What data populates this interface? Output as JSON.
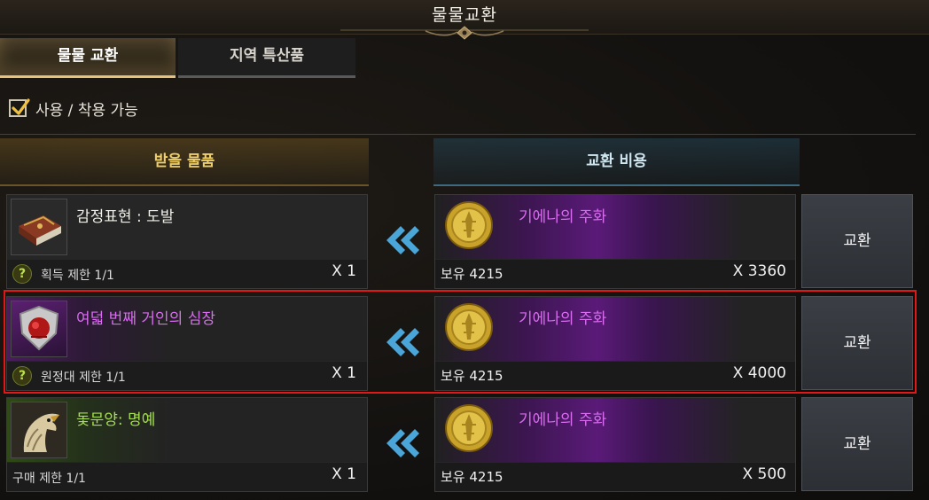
{
  "window": {
    "title": "물물교환"
  },
  "tabs": [
    {
      "label": "물물 교환",
      "active": true
    },
    {
      "label": "지역 특산품",
      "active": false
    }
  ],
  "filter": {
    "label": "사용 / 착용 가능",
    "checked": true
  },
  "columns": {
    "receive": "받을 물품",
    "cost": "교환 비용"
  },
  "rows": [
    {
      "item": {
        "name": "감정표현 : 도발",
        "name_color": "#f0efe8",
        "icon": "book-icon",
        "limit": "획득 제한 1/1",
        "quantity": "X 1"
      },
      "cost": {
        "name": "기에나의 주화",
        "icon": "gold-coin-icon",
        "owned": "보유 4215",
        "quantity": "X 3360"
      },
      "button": "교환"
    },
    {
      "item": {
        "name": "여덟 번째 거인의 심장",
        "name_color": "#d96bf0",
        "icon": "giant-heart-icon",
        "limit": "원정대 제한 1/1",
        "quantity": "X 1"
      },
      "cost": {
        "name": "기에나의 주화",
        "icon": "gold-coin-icon",
        "owned": "보유 4215",
        "quantity": "X 4000"
      },
      "button": "교환",
      "highlighted": true
    },
    {
      "item": {
        "name": "돛문양: 명예",
        "name_color": "#a4e048",
        "icon": "eagle-icon",
        "limit": "구매 제한 1/1",
        "quantity": "X 1"
      },
      "cost": {
        "name": "기에나의 주화",
        "icon": "gold-coin-icon",
        "owned": "보유 4215",
        "quantity": "X 500"
      },
      "button": "교환"
    }
  ],
  "colors": {
    "accent_gold": "#e6c27a",
    "highlight_red": "#e01818",
    "epic_purple": "#d96bf0",
    "uncommon_green": "#a4e048"
  }
}
